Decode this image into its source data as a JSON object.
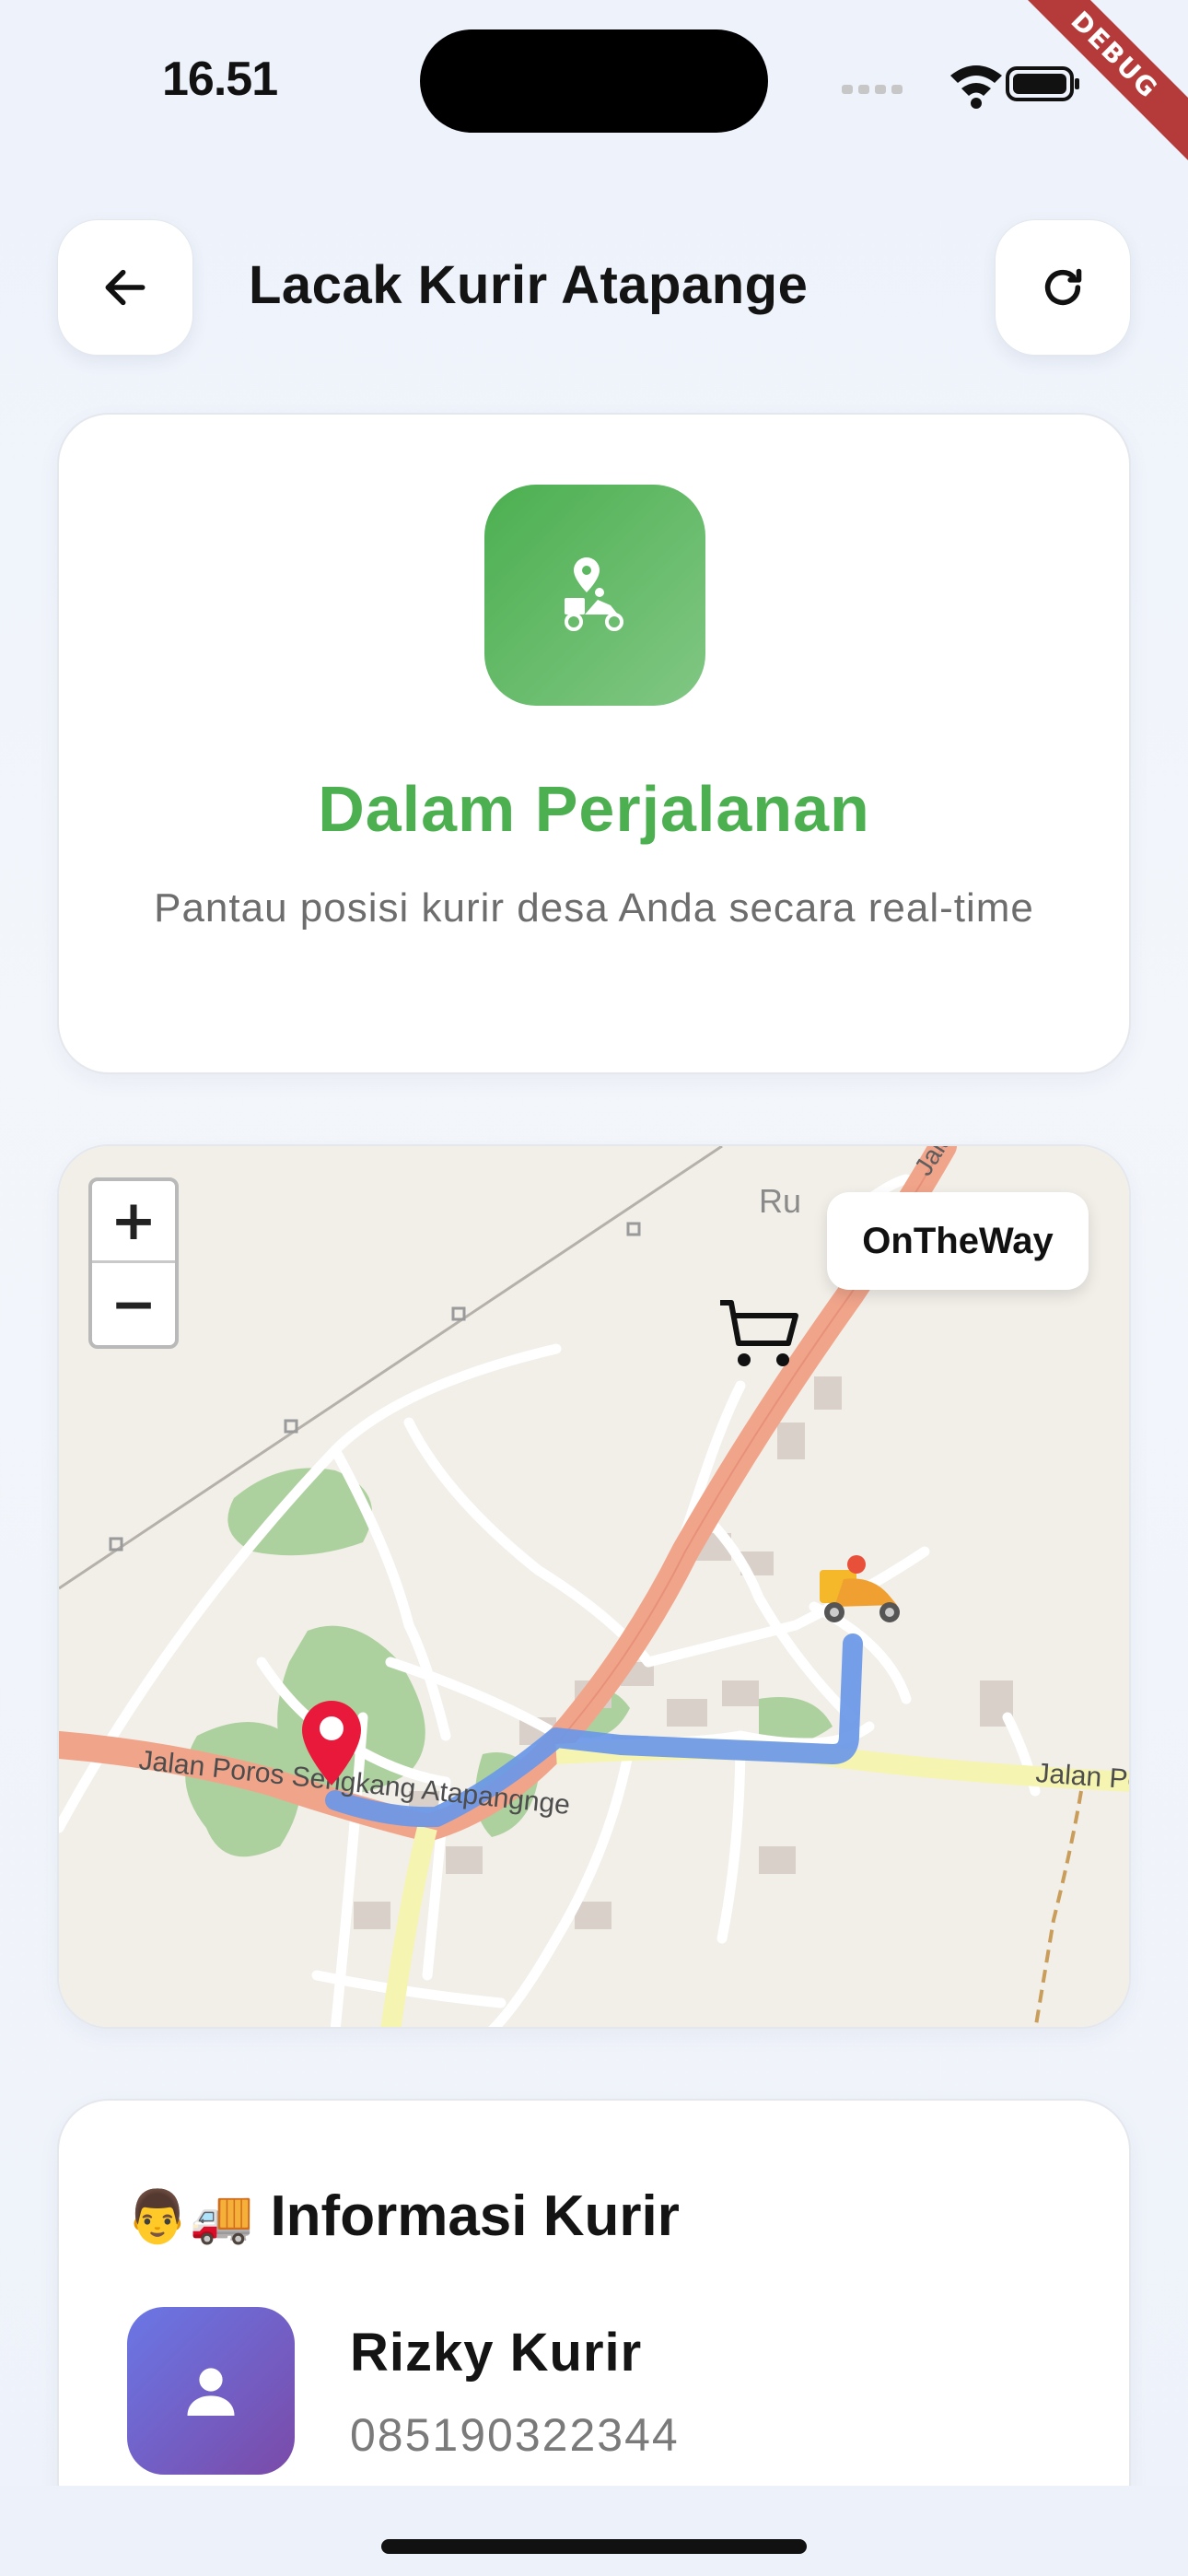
{
  "status_bar": {
    "time": "16.51",
    "debug_label": "DEBUG"
  },
  "header": {
    "title": "Lacak Kurir Atapange",
    "back_icon": "arrow-left-icon",
    "refresh_icon": "refresh-icon"
  },
  "status_card": {
    "icon": "courier-location-icon",
    "title": "Dalam Perjalanan",
    "subtitle": "Pantau posisi kurir desa Anda secara real-time",
    "accent_color": "#4caf50"
  },
  "map": {
    "status_badge": "OnTheWay",
    "zoom_in": "+",
    "zoom_out": "−",
    "labels": {
      "road_main": "Jalan Poros Sengkang Atapangnge",
      "road_east": "Jalan Po",
      "place_top": "Ru",
      "road_top": "Jalan"
    },
    "markers": [
      "shop-cart-icon",
      "destination-pin-icon",
      "courier-scooter-icon"
    ],
    "route_color": "#6a97e8"
  },
  "courier_info": {
    "title_emoji": "👨🚚",
    "title": "Informasi Kurir",
    "name": "Rizky Kurir",
    "phone": "085190322344"
  }
}
